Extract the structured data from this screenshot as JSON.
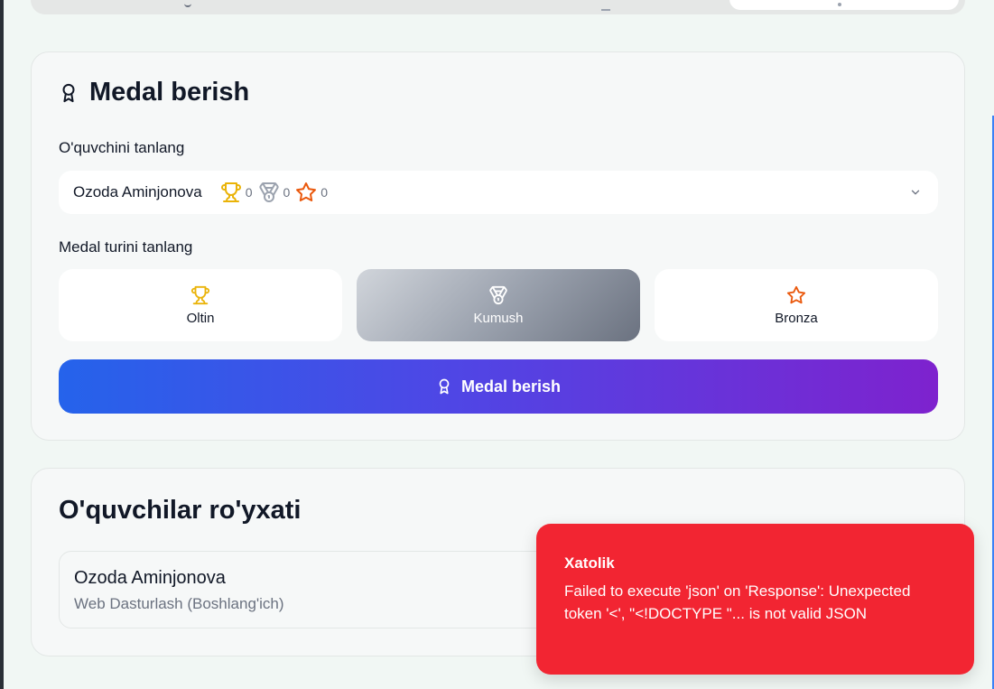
{
  "medal_card": {
    "title": "Medal berish",
    "student_label": "O'quvchini tanlang",
    "selected_student": {
      "name": "Ozoda Aminjonova",
      "gold_count": "0",
      "silver_count": "0",
      "bronze_count": "0"
    },
    "type_label": "Medal turini tanlang",
    "types": [
      {
        "label": "Oltin",
        "icon": "trophy-icon",
        "color": "#eab308"
      },
      {
        "label": "Kumush",
        "icon": "medal-icon",
        "color": "#ffffff",
        "selected": true
      },
      {
        "label": "Bronza",
        "icon": "star-icon",
        "color": "#ea580c"
      }
    ],
    "submit_label": "Medal berish"
  },
  "list_card": {
    "title": "O'quvchilar ro'yxati",
    "students": [
      {
        "name": "Ozoda Aminjonova",
        "course": "Web Dasturlash (Boshlang'ich)"
      }
    ]
  },
  "toast": {
    "title": "Xatolik",
    "message": "Failed to execute 'json' on 'Response': Unexpected token '<', \"<!DOCTYPE \"... is not valid JSON",
    "color": "#f22532"
  }
}
